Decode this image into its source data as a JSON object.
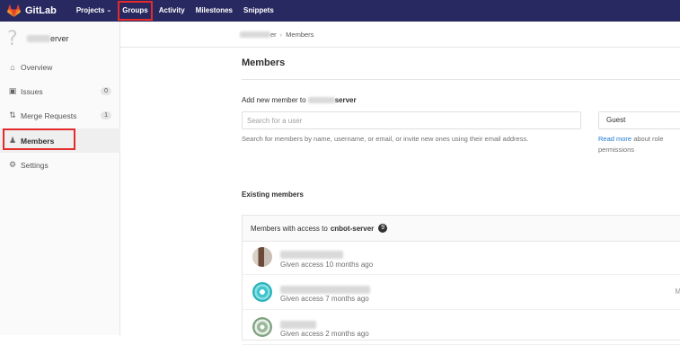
{
  "nav": {
    "brand": "GitLab",
    "items": [
      {
        "label": "Projects",
        "has_dropdown": true
      },
      {
        "label": "Groups",
        "highlighted": true
      },
      {
        "label": "Activity"
      },
      {
        "label": "Milestones"
      },
      {
        "label": "Snippets"
      }
    ]
  },
  "sidebar": {
    "project_name_suffix": "erver",
    "items": [
      {
        "label": "Overview",
        "icon": "home-icon"
      },
      {
        "label": "Issues",
        "icon": "issues-icon",
        "count": "0"
      },
      {
        "label": "Merge Requests",
        "icon": "merge-request-icon",
        "count": "1"
      },
      {
        "label": "Members",
        "icon": "members-icon",
        "active": true
      },
      {
        "label": "Settings",
        "icon": "settings-icon"
      }
    ]
  },
  "breadcrumb": {
    "parent_suffix": "er",
    "current": "Members"
  },
  "page": {
    "title": "Members",
    "add_member_label": "Add new member to",
    "add_member_target_suffix": "server",
    "search_placeholder": "Search for a user",
    "helper_text": "Search for members by name, username, or email, or invite new ones using their email address.",
    "role_value": "Guest",
    "role_help_link": "Read more",
    "role_help_text_line1": " about role",
    "role_help_text_line2": "permissions",
    "existing_title": "Existing members",
    "panel_prefix": "Members with access to",
    "panel_project": "cnbot-server",
    "member_count": "9"
  },
  "members": [
    {
      "given": "Given access 10 months ago"
    },
    {
      "given": "Given access 7 months ago"
    },
    {
      "given": "Given access 2 months ago"
    }
  ],
  "colors": {
    "nav_bg": "#292961",
    "highlight_box": "#e32b2b",
    "link": "#1f78d1"
  }
}
